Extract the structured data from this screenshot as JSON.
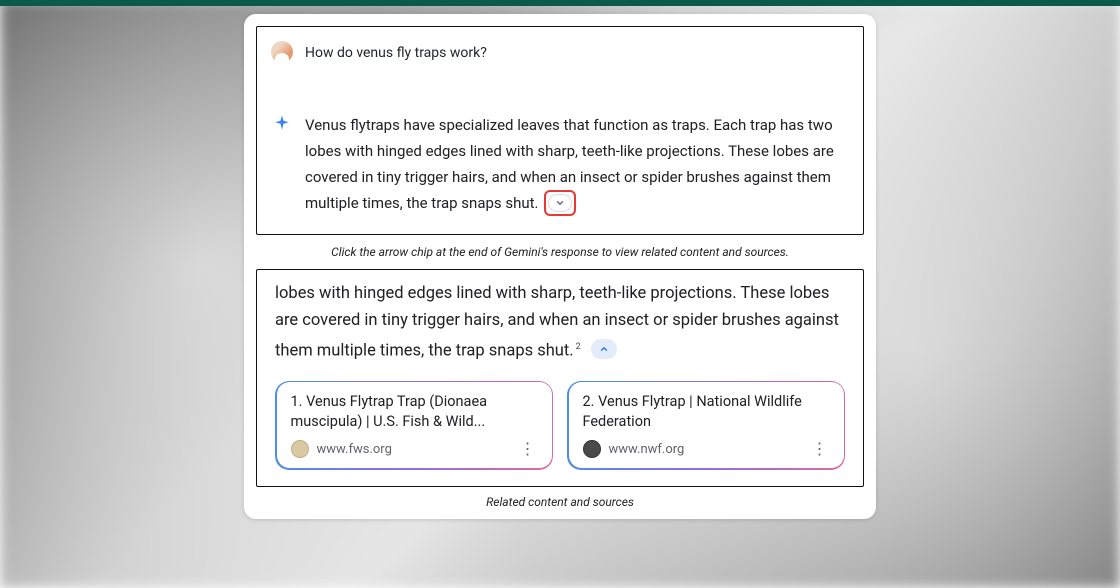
{
  "conversation": {
    "prompt": "How do venus fly traps work?",
    "response": "Venus flytraps have specialized leaves that function as traps. Each trap has two lobes with hinged edges lined with sharp, teeth-like projections.  These lobes are covered in tiny trigger hairs, and when an insect or spider brushes against them multiple times, the trap snaps shut."
  },
  "captions": {
    "top": "Click the arrow chip at the end of Gemini's response to view related content and sources.",
    "bottom": "Related content and sources"
  },
  "expanded": {
    "trailing_text": "lobes with hinged edges lined with sharp, teeth-like projections.  These lobes are covered in tiny trigger hairs, and when an insect or spider brushes against them multiple times, the trap snaps shut.",
    "citation_marker": "2"
  },
  "sources": [
    {
      "index": "1.",
      "title": "Venus Flytrap Trap (Dionaea muscipula) | U.S. Fish & Wild...",
      "domain": "www.fws.org"
    },
    {
      "index": "2.",
      "title": "Venus Flytrap | National Wildlife Federation",
      "domain": "www.nwf.org"
    }
  ],
  "icons": {
    "user_avatar": "user-avatar",
    "ai_sparkle": "sparkle-icon",
    "chevron_down": "chevron-down-icon",
    "chevron_up": "chevron-up-icon",
    "more": "more-vertical-icon"
  }
}
